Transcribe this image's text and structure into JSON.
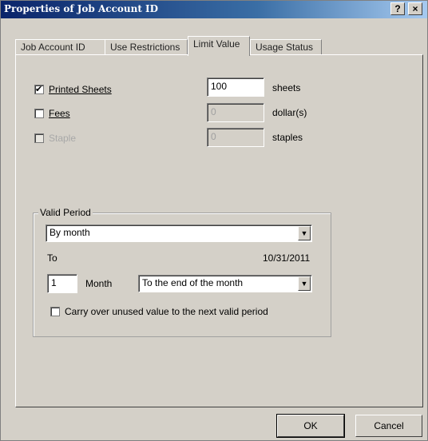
{
  "window": {
    "title": "Properties of Job Account ID",
    "help_button": "?",
    "close_button": "×"
  },
  "tabs": [
    {
      "label": "Job Account ID",
      "active": false
    },
    {
      "label": "Use Restrictions",
      "active": false
    },
    {
      "label": "Limit Value",
      "active": true
    },
    {
      "label": "Usage Status",
      "active": false
    }
  ],
  "limits": {
    "printed_sheets": {
      "label": "Printed Sheets",
      "checked": true,
      "enabled": true,
      "value": "100",
      "unit": "sheets"
    },
    "fees": {
      "label": "Fees",
      "checked": false,
      "enabled": true,
      "value": "0",
      "unit": "dollar(s)"
    },
    "staple": {
      "label": "Staple",
      "checked": false,
      "enabled": false,
      "value": "0",
      "unit": "staples"
    }
  },
  "valid_period": {
    "legend": "Valid Period",
    "period_select": "By month",
    "to_label": "To",
    "to_date": "10/31/2011",
    "count_value": "1",
    "count_unit": "Month",
    "end_select": "To the end of the month",
    "carry_over_label": "Carry over unused value to the next valid period",
    "carry_over_checked": false
  },
  "buttons": {
    "ok": "OK",
    "cancel": "Cancel"
  },
  "colors": {
    "titlebar_start": "#0a246a",
    "titlebar_end": "#a6caf0",
    "dialog_bg": "#d4d0c8"
  }
}
